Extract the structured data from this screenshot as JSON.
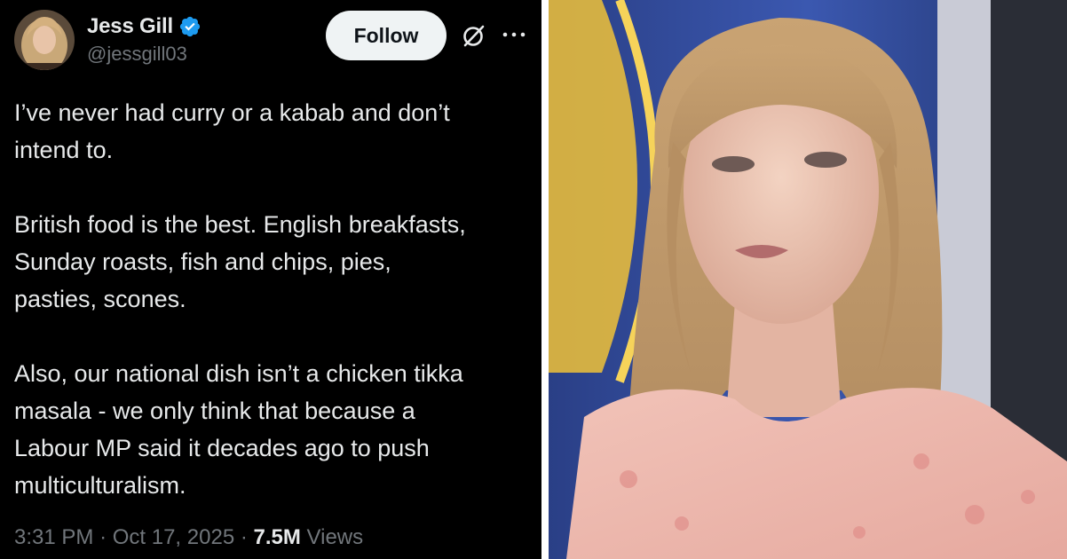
{
  "tweet": {
    "display_name": "Jess Gill",
    "handle": "@jessgill03",
    "follow_label": "Follow",
    "paragraphs": [
      "I’ve never had curry or a kabab and don’t\nintend to.",
      "British food is the best. English breakfasts,\nSunday roasts, fish and chips, pies,\npasties, scones.",
      "Also, our national dish isn’t a chicken tikka\nmasala - we only think that because a\nLabour MP said it decades ago to push\nmulticulturalism."
    ],
    "time": "3:31 PM",
    "date": "Oct 17, 2025",
    "views_count": "7.5M",
    "views_label": "Views",
    "separator": "·",
    "icons": {
      "verified": "verified-badge-icon",
      "grok": "grok-icon",
      "more": "more-options-icon"
    }
  },
  "colors": {
    "tweet_background": "#000000",
    "primary_text": "#e7e9ea",
    "secondary_text": "#71767b",
    "verified_blue": "#1d9bf0",
    "follow_button_bg": "#eff3f4"
  },
  "photo": {
    "subject": "woman-with-blonde-fringe-portrait"
  }
}
